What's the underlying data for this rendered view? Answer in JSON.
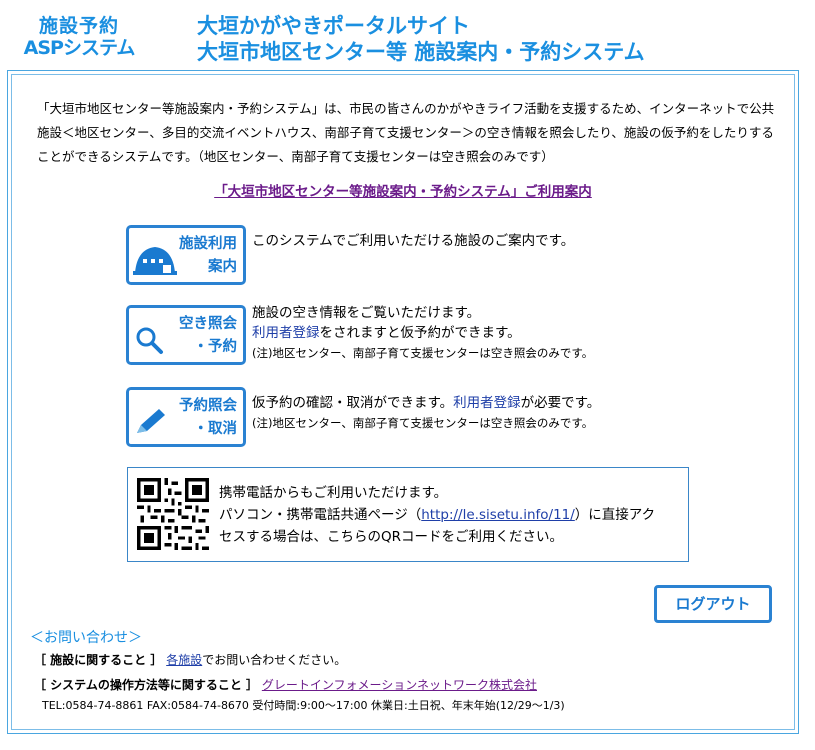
{
  "header": {
    "logo_line1": "施設予約",
    "logo_line2": "ASPシステム",
    "title_line1": "大垣かがやきポータルサイト",
    "title_line2": "大垣市地区センター等 施設案内・予約システム"
  },
  "intro": {
    "text": "「大垣市地区センター等施設案内・予約システム」は、市民の皆さんのかがやきライフ活動を支援するため、インターネットで公共施設＜地区センター、多目的交流イベントハウス、南部子育て支援センター＞の空き情報を照会したり、施設の仮予約をしたりすることができるシステムです。（地区センター、南部子育て支援センターは空き照会のみです）"
  },
  "guide_link": "「大垣市地区センター等施設案内・予約システム」ご利用案内",
  "features": {
    "facility": {
      "label1": "施設利用",
      "label2": "案内",
      "desc": "このシステムでご利用いただける施設のご案内です。"
    },
    "availability": {
      "label1": "空き照会",
      "label2": "・予約",
      "desc1": "施設の空き情報をご覧いただけます。",
      "desc2_link": "利用者登録",
      "desc2_rest": "をされますと仮予約ができます。",
      "note": "(注)地区センター、南部子育て支援センターは空き照会のみです。"
    },
    "reservation": {
      "label1": "予約照会",
      "label2": "・取消",
      "desc1": "仮予約の確認・取消ができます。",
      "desc1_link": "利用者登録",
      "desc1_rest": "が必要です。",
      "note": "(注)地区センター、南部子育て支援センターは空き照会のみです。"
    }
  },
  "mobile": {
    "line1": "携帯電話からもご利用いただけます。",
    "line2_pre": "パソコン・携帯電話共通ページ（",
    "url": "http://le.sisetu.info/11/",
    "line2_post": "）に直接アク",
    "line3": "セスする場合は、こちらのQRコードをご利用ください。"
  },
  "logout_label": "ログアウト",
  "contact": {
    "heading": "＜お問い合わせ＞",
    "row1_label": "［ 施設に関すること ］",
    "row1_link": "各施設",
    "row1_rest": "でお問い合わせください。",
    "row2_label": "［ システムの操作方法等に関すること ］",
    "row2_link": "グレートインフォメーションネットワーク株式会社",
    "tel": "TEL:0584-74-8861 FAX:0584-74-8670 受付時間:9:00～17:00 休業日:土日祝、年末年始(12/29～1/3)"
  },
  "colors": {
    "accent": "#1a8fe0",
    "button_border": "#2a82d2",
    "link": "#1f3fa8",
    "visited_link": "#6b1b8a"
  }
}
